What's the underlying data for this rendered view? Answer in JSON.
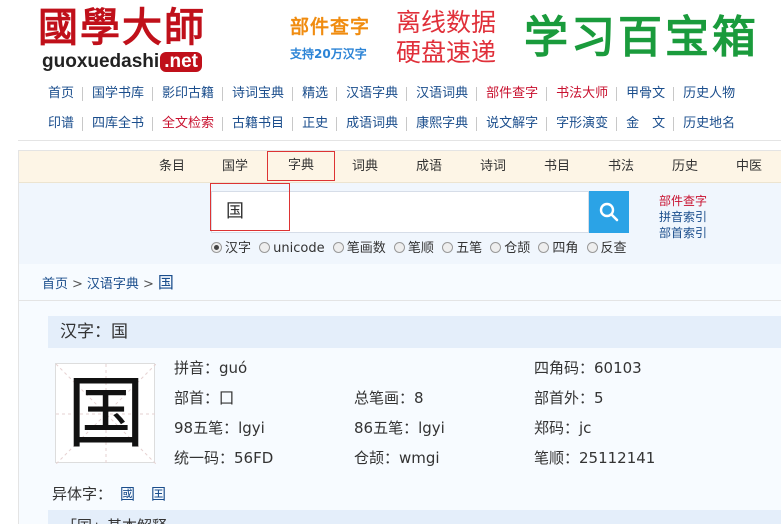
{
  "logo": {
    "text_cn": "國學大師",
    "text_en": "guoxuedashi",
    "text_net": ".net"
  },
  "ad": {
    "line1": "部件查字",
    "line2": "支持20万汉字",
    "offline1": "离线数据",
    "offline2": "硬盘速递",
    "slogan": "学习百宝箱"
  },
  "nav1": [
    "首页",
    "国学书库",
    "影印古籍",
    "诗词宝典",
    "精选",
    "汉语字典",
    "汉语词典",
    "部件查字",
    "书法大师",
    "甲骨文",
    "历史人物"
  ],
  "nav2": [
    "印谱",
    "四库全书",
    "全文检索",
    "古籍书目",
    "正史",
    "成语词典",
    "康熙字典",
    "说文解字",
    "字形演变",
    "金　文",
    "历史地名"
  ],
  "tabs": [
    "条目",
    "国学",
    "字典",
    "词典",
    "成语",
    "诗词",
    "书目",
    "书法",
    "历史",
    "中医"
  ],
  "search": {
    "value": "国"
  },
  "radios": [
    "汉字",
    "unicode",
    "笔画数",
    "笔顺",
    "五笔",
    "仓颉",
    "四角",
    "反查"
  ],
  "side_links": [
    "部件查字",
    "拼音索引",
    "部首索引"
  ],
  "breadcrumb": {
    "home": "首页",
    "dict": "汉语字典",
    "current": "国",
    "sep": ">"
  },
  "char": {
    "header": "汉字：国",
    "glyph": "国",
    "pinyin": "拼音：guó",
    "sijiao": "四角码：60103",
    "bushou": "部首：囗",
    "zongbihua": "总笔画：8",
    "bushouwai": "部首外：5",
    "wubi98": "98五笔：lgyi",
    "wubi86": "86五笔：lgyi",
    "zhengma": "郑码：jc",
    "unicode": "统一码：56FD",
    "cangjie": "仓颉：wmgi",
    "bishun": "笔顺：25112141",
    "variants_label": "异体字：",
    "variants": [
      "國",
      "囯"
    ],
    "next_header": "「国」基本解释"
  }
}
